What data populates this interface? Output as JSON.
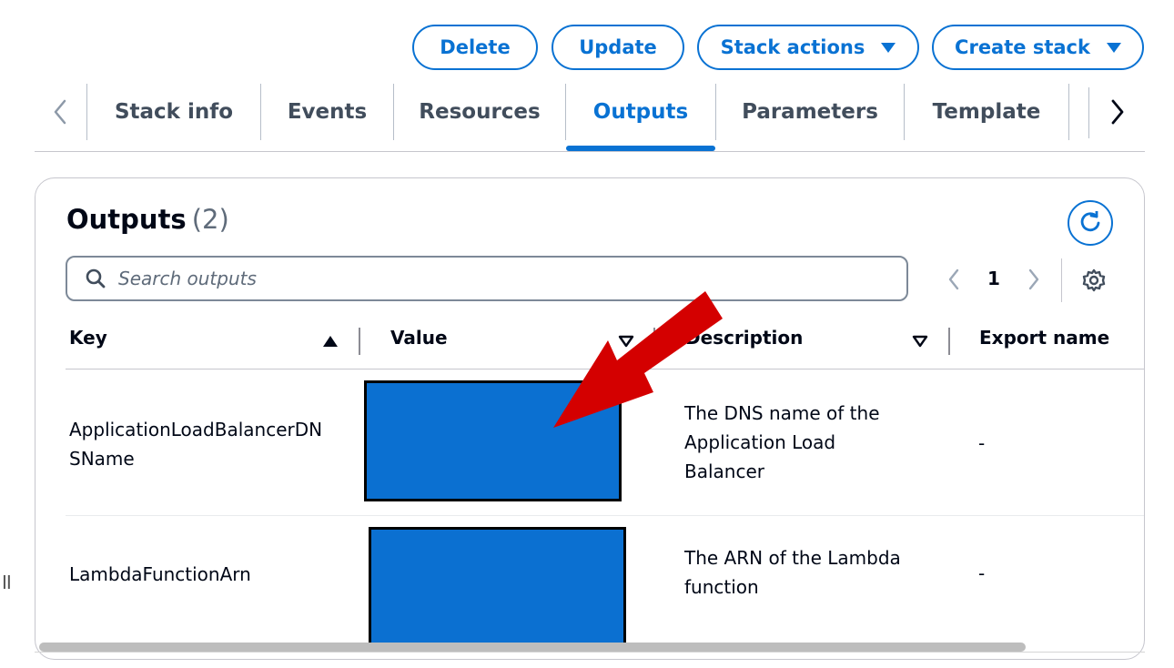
{
  "header": {
    "buttons": {
      "delete": "Delete",
      "update": "Update",
      "stack_actions": "Stack actions",
      "create_stack": "Create stack"
    }
  },
  "tabs": [
    {
      "label": "Stack info"
    },
    {
      "label": "Events"
    },
    {
      "label": "Resources"
    },
    {
      "label": "Outputs",
      "active": true
    },
    {
      "label": "Parameters"
    },
    {
      "label": "Template"
    }
  ],
  "panel": {
    "title": "Outputs",
    "count": "(2)",
    "search_placeholder": "Search outputs",
    "pagination": {
      "current_page": "1"
    },
    "columns": {
      "key": "Key",
      "value": "Value",
      "description": "Description",
      "export_name": "Export name"
    },
    "rows": [
      {
        "key_line1": "ApplicationLoadBalancerDN",
        "key_line2": "SName",
        "desc_line1": "The DNS name of the",
        "desc_line2": "Application Load",
        "desc_line3": "Balancer",
        "export_name": "-"
      },
      {
        "key_line1": "LambdaFunctionArn",
        "desc_line1": "The ARN of the Lambda",
        "desc_line2": "function",
        "export_name": "-"
      }
    ]
  },
  "colors": {
    "accent": "#0972d3",
    "redaction": "#0b70d1",
    "annotation_arrow": "#d40000"
  },
  "misc": {
    "side_handle": "II"
  }
}
